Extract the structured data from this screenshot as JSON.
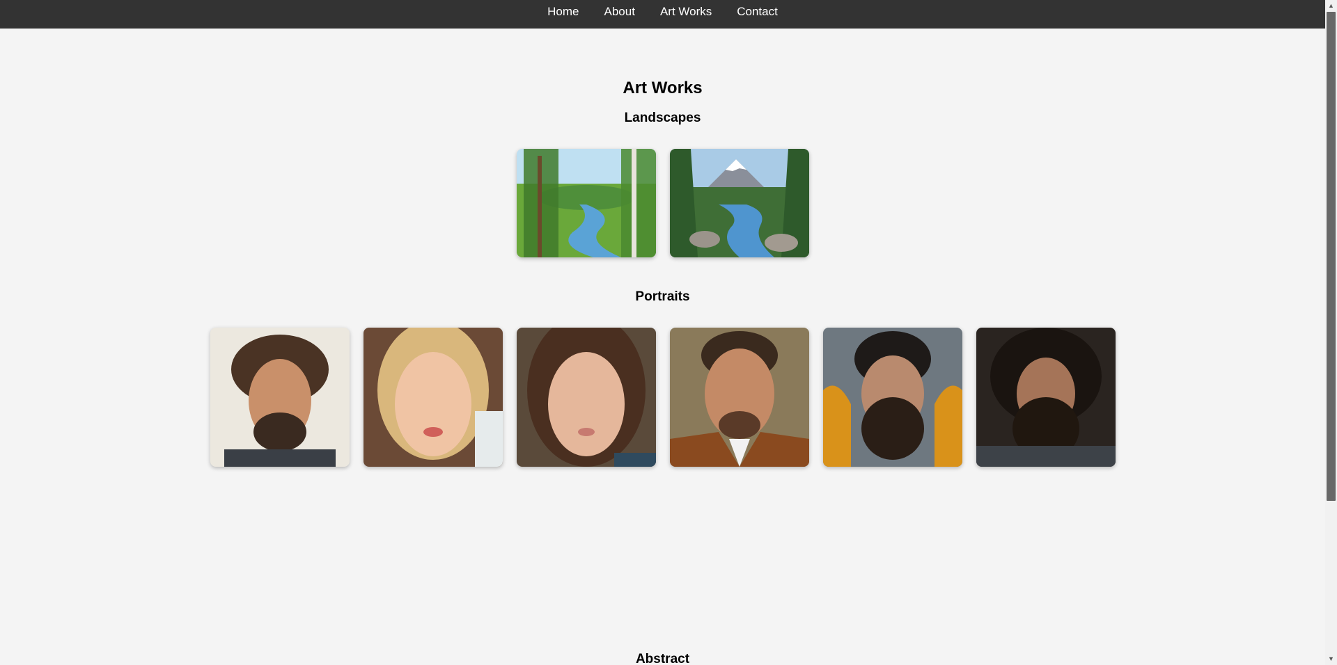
{
  "nav": {
    "items": [
      {
        "label": "Home"
      },
      {
        "label": "About"
      },
      {
        "label": "Art Works"
      },
      {
        "label": "Contact"
      }
    ]
  },
  "page": {
    "title": "Art Works"
  },
  "sections": {
    "landscapes": {
      "title": "Landscapes"
    },
    "portraits": {
      "title": "Portraits"
    },
    "abstract": {
      "title": "Abstract"
    }
  },
  "colors": {
    "navbar": "#333333",
    "background": "#f4f4f4",
    "nav_text": "#ffffff"
  }
}
